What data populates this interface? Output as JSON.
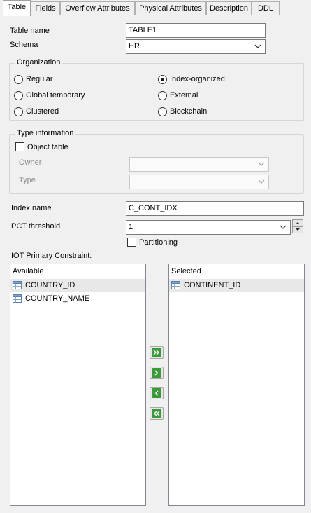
{
  "tabs": [
    {
      "label": "Table"
    },
    {
      "label": "Fields"
    },
    {
      "label": "Overflow Attributes"
    },
    {
      "label": "Physical Attributes"
    },
    {
      "label": "Description"
    },
    {
      "label": "DDL"
    }
  ],
  "form": {
    "table_name_label": "Table name",
    "table_name_value": "TABLE1",
    "schema_label": "Schema",
    "schema_value": "HR"
  },
  "organization": {
    "title": "Organization",
    "options": {
      "regular": "Regular",
      "global_temporary": "Global temporary",
      "clustered": "Clustered",
      "index_organized": "Index-organized",
      "external": "External",
      "blockchain": "Blockchain"
    },
    "selected": "Index-organized"
  },
  "type_info": {
    "title": "Type information",
    "object_table_label": "Object table",
    "owner_label": "Owner",
    "type_label": "Type"
  },
  "index": {
    "name_label": "Index name",
    "name_value": "C_CONT_IDX",
    "pct_label": "PCT threshold",
    "pct_value": "1",
    "partitioning_label": "Partitioning"
  },
  "iot": {
    "label": "IOT Primary Constraint:",
    "available_header": "Available",
    "selected_header": "Selected",
    "available_items": [
      "COUNTRY_ID",
      "COUNTRY_NAME"
    ],
    "selected_items": [
      "CONTINENT_ID"
    ]
  },
  "colors": {
    "accent_green": "#3a9a3a",
    "active_tab_bg": "#ffffff",
    "panel_bg": "#f0f0f0"
  }
}
